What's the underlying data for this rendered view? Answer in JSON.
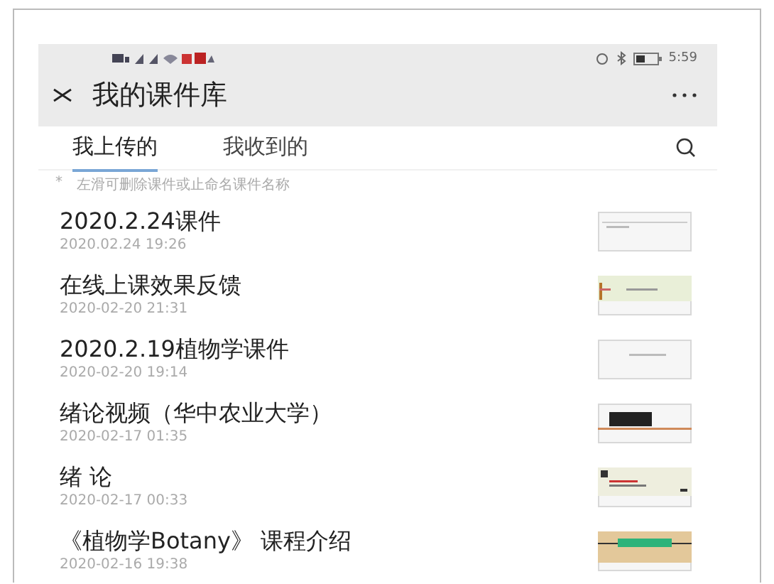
{
  "status_bar": {
    "time": "5:59"
  },
  "header": {
    "title": "我的课件库"
  },
  "tabs": [
    {
      "label": "我上传的",
      "selected": true
    },
    {
      "label": "我收到的",
      "selected": false
    }
  ],
  "hint": {
    "mark": "*",
    "text": "左滑可删除课件或止命名课件名称"
  },
  "courseware": [
    {
      "title": "2020.2.24课件",
      "date": "2020.02.24 19:26"
    },
    {
      "title": "在线上课效果反馈",
      "date": "2020-02-20 21:31"
    },
    {
      "title": "2020.2.19植物学课件",
      "date": "2020-02-20 19:14"
    },
    {
      "title": "绪论视频（华中农业大学）",
      "date": "2020-02-17 01:35"
    },
    {
      "title": "绪 论",
      "date": "2020-02-17 00:33"
    },
    {
      "title": "《植物学Botany》 课程介绍",
      "date": "2020-02-16 19:38"
    }
  ]
}
